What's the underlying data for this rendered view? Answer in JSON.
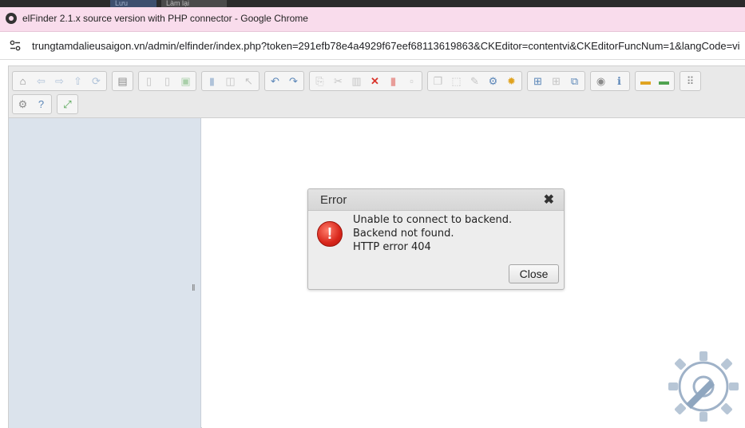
{
  "browser": {
    "window_title": "elFinder 2.1.x source version with PHP connector - Google Chrome",
    "url": "trungtamdalieusaigon.vn/admin/elfinder/index.php?token=291efb78e4a4929f67eef68113619863&CKEditor=contentvi&CKEditorFuncNum=1&langCode=vi",
    "background_buttons": [
      "Lưu",
      "Làm lại"
    ]
  },
  "toolbar": {
    "row1": [
      [
        {
          "icon": "home-icon",
          "glyph": "⌂",
          "tone": "gray",
          "disabled": false
        },
        {
          "icon": "back-icon",
          "glyph": "⇦",
          "tone": "blue",
          "disabled": true
        },
        {
          "icon": "forward-icon",
          "glyph": "⇨",
          "tone": "blue",
          "disabled": true
        },
        {
          "icon": "up-icon",
          "glyph": "⇧",
          "tone": "blue",
          "disabled": true
        },
        {
          "icon": "reload-icon",
          "glyph": "⟳",
          "tone": "blue",
          "disabled": true
        }
      ],
      [
        {
          "icon": "netmount-icon",
          "glyph": "▤",
          "tone": "gray",
          "disabled": false
        }
      ],
      [
        {
          "icon": "mkdir-icon",
          "glyph": "▯",
          "tone": "gray",
          "disabled": true
        },
        {
          "icon": "mkfile-icon",
          "glyph": "▯",
          "tone": "gray",
          "disabled": true
        },
        {
          "icon": "upload-icon",
          "glyph": "▣",
          "tone": "green",
          "disabled": true
        }
      ],
      [
        {
          "icon": "open-icon",
          "glyph": "▮",
          "tone": "blue",
          "disabled": true
        },
        {
          "icon": "download-icon",
          "glyph": "◫",
          "tone": "gray",
          "disabled": true
        },
        {
          "icon": "select-icon",
          "glyph": "↖",
          "tone": "gray",
          "disabled": true
        }
      ],
      [
        {
          "icon": "undo-icon",
          "glyph": "↶",
          "tone": "blue",
          "disabled": false
        },
        {
          "icon": "redo-icon",
          "glyph": "↷",
          "tone": "blue",
          "disabled": false
        }
      ],
      [
        {
          "icon": "copy-icon",
          "glyph": "⎘",
          "tone": "gray",
          "disabled": true
        },
        {
          "icon": "cut-icon",
          "glyph": "✂",
          "tone": "gray",
          "disabled": true
        },
        {
          "icon": "paste-icon",
          "glyph": "▥",
          "tone": "gray",
          "disabled": true
        },
        {
          "icon": "delete-icon",
          "glyph": "✕",
          "tone": "red",
          "disabled": false
        },
        {
          "icon": "trash-icon",
          "glyph": "▮",
          "tone": "red",
          "disabled": true
        },
        {
          "icon": "empty-icon",
          "glyph": "▫",
          "tone": "gray",
          "disabled": true
        }
      ],
      [
        {
          "icon": "duplicate-icon",
          "glyph": "❐",
          "tone": "gray",
          "disabled": true
        },
        {
          "icon": "rename-icon",
          "glyph": "⬚",
          "tone": "gray",
          "disabled": true
        },
        {
          "icon": "edit-icon",
          "glyph": "✎",
          "tone": "gray",
          "disabled": true
        },
        {
          "icon": "resize-icon",
          "glyph": "⚙",
          "tone": "blue",
          "disabled": false
        },
        {
          "icon": "extract-icon",
          "glyph": "✹",
          "tone": "orange",
          "disabled": false
        }
      ],
      [
        {
          "icon": "icons-view-icon",
          "glyph": "⊞",
          "tone": "blue",
          "disabled": false
        },
        {
          "icon": "list-view-icon",
          "glyph": "⊞",
          "tone": "gray",
          "disabled": true
        },
        {
          "icon": "sort-icon",
          "glyph": "⧉",
          "tone": "blue",
          "disabled": false
        }
      ],
      [
        {
          "icon": "preview-icon",
          "glyph": "◉",
          "tone": "gray",
          "disabled": false
        },
        {
          "icon": "info-icon",
          "glyph": "ℹ",
          "tone": "blue",
          "disabled": false
        }
      ],
      [
        {
          "icon": "preferences-icon",
          "glyph": "▬",
          "tone": "orange",
          "disabled": false
        },
        {
          "icon": "fullscreen-icon",
          "glyph": "▬",
          "tone": "green",
          "disabled": false
        }
      ],
      [
        {
          "icon": "view-icon",
          "glyph": "⠿",
          "tone": "gray",
          "disabled": false
        }
      ]
    ],
    "row2": [
      [
        {
          "icon": "settings-icon",
          "glyph": "⚙",
          "tone": "gray",
          "disabled": false
        },
        {
          "icon": "help-icon",
          "glyph": "?",
          "tone": "blue",
          "disabled": false
        }
      ],
      [
        {
          "icon": "maximize-icon",
          "glyph": "⤢",
          "tone": "green",
          "disabled": false
        }
      ]
    ]
  },
  "dialog": {
    "title": "Error",
    "close_glyph": "✖",
    "icon_glyph": "!",
    "messages": [
      "Unable to connect to backend.",
      "Backend not found.",
      "HTTP error 404"
    ],
    "close_button": "Close"
  },
  "colors": {
    "titlebar": "#f9dcec",
    "navbar": "#dbe3ec",
    "dialog_bg": "#ededed",
    "error_red": "#d8261b"
  }
}
